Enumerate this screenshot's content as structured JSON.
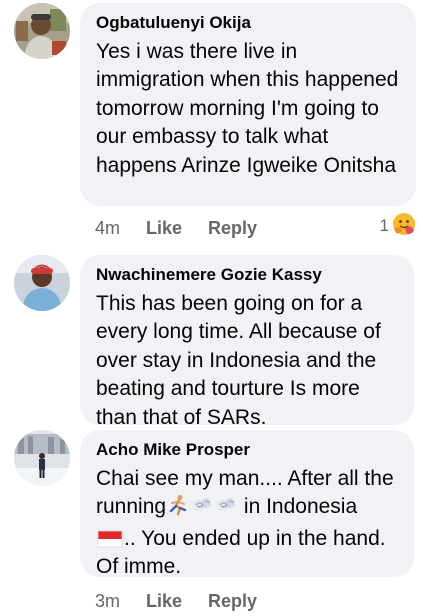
{
  "comments": [
    {
      "author": "Ogbatuluenyi Okija",
      "text": "Yes i was there live in immigration when this happened tomorrow morning I'm going to our embassy to talk what happens Arinze Igweike Onitsha",
      "time": "4m",
      "like_label": "Like",
      "reply_label": "Reply",
      "reaction_count": "1",
      "reaction_icon": "hug-emoji-icon"
    },
    {
      "author": "Nwachinemere Gozie Kassy",
      "text": "This has been going on for a every long time. All because of over stay in Indonesia and the beating and tourture Is more than that of SARs."
    },
    {
      "author": "Acho Mike Prosper",
      "text_line1": "Chai see my man.... After all the",
      "text_running": "running",
      "text_in_indonesia": " in Indonesia",
      "text_you_ended": ".. You ended up in the hand.",
      "text_of_imme": "Of imme.",
      "emoji_icons": [
        "running-man-icon",
        "dash-icon",
        "dash-icon",
        "indonesia-flag-icon"
      ],
      "time": "3m",
      "like_label": "Like",
      "reply_label": "Reply"
    }
  ],
  "colors": {
    "bubble": "#f0f2f5",
    "meta": "#65676b",
    "text": "#050505"
  }
}
